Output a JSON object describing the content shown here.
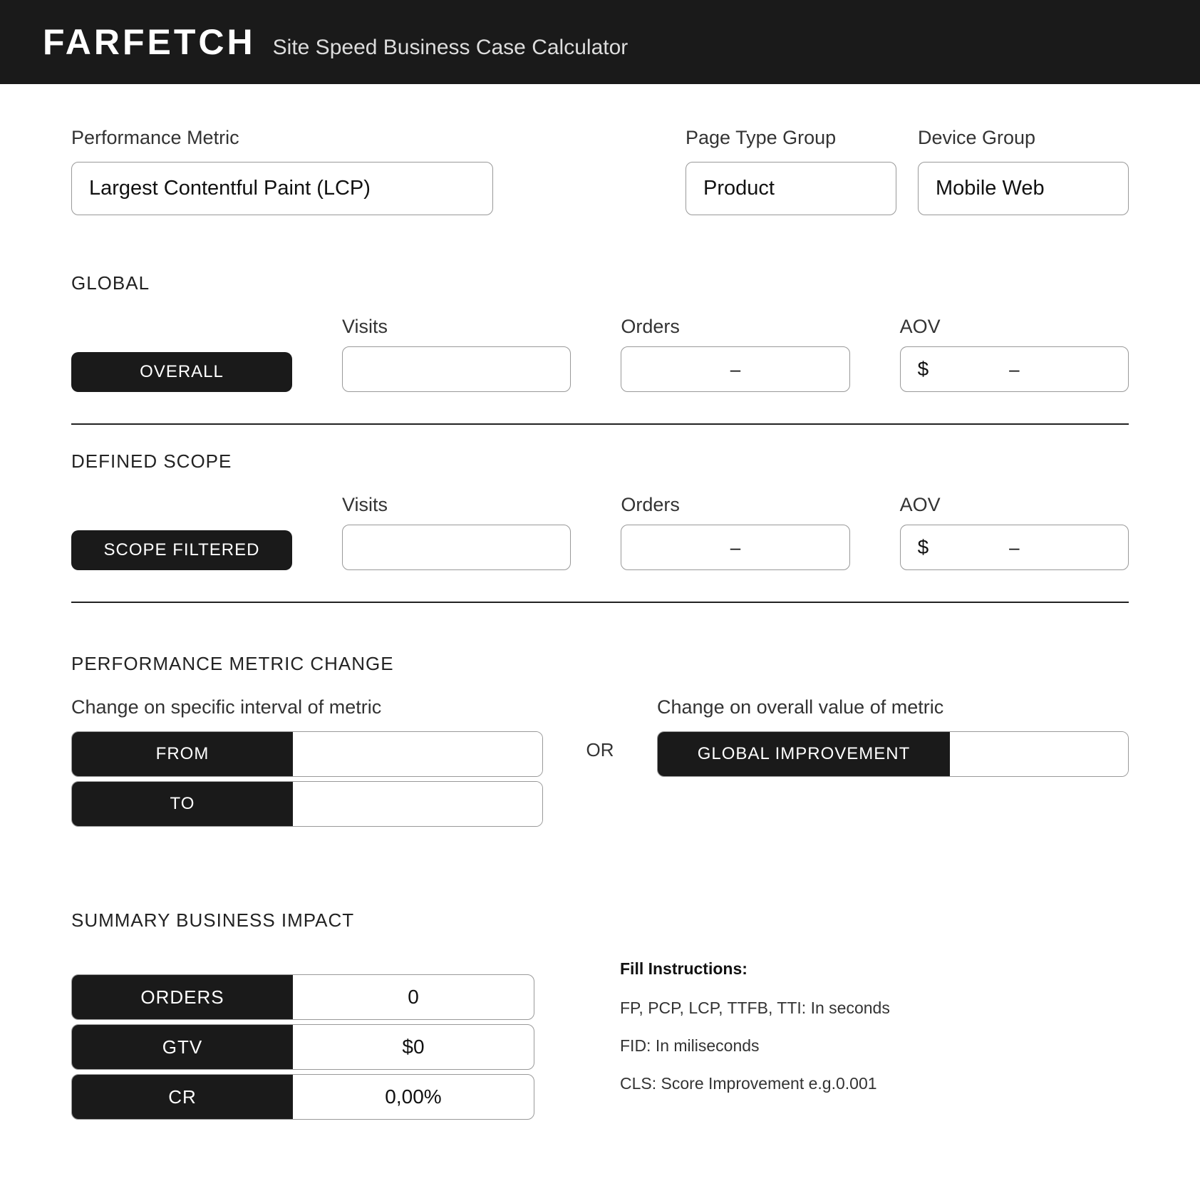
{
  "header": {
    "logo": "FARFETCH",
    "subtitle": "Site Speed Business Case Calculator"
  },
  "filters": {
    "metric": {
      "label": "Performance Metric",
      "value": "Largest Contentful Paint (LCP)"
    },
    "page": {
      "label": "Page Type Group",
      "value": "Product"
    },
    "device": {
      "label": "Device Group",
      "value": "Mobile Web"
    }
  },
  "global": {
    "label": "GLOBAL",
    "badge": "OVERALL",
    "visits": {
      "label": "Visits",
      "value": ""
    },
    "orders": {
      "label": "Orders",
      "value": "–"
    },
    "aov": {
      "label": "AOV",
      "prefix": "$",
      "value": "–"
    }
  },
  "scope": {
    "label": "DEFINED SCOPE",
    "badge": "SCOPE FILTERED",
    "visits": {
      "label": "Visits",
      "value": ""
    },
    "orders": {
      "label": "Orders",
      "value": "–"
    },
    "aov": {
      "label": "AOV",
      "prefix": "$",
      "value": "–"
    }
  },
  "change": {
    "label": "PERFORMANCE METRIC CHANGE",
    "specific": {
      "sublabel": "Change on specific interval of metric",
      "from_label": "FROM",
      "from_value": "",
      "to_label": "TO",
      "to_value": ""
    },
    "or": "OR",
    "overall": {
      "sublabel": "Change on overall value of metric",
      "global_label": "GLOBAL IMPROVEMENT",
      "global_value": ""
    }
  },
  "summary": {
    "label": "SUMMARY BUSINESS IMPACT",
    "orders": {
      "label": "ORDERS",
      "value": "0"
    },
    "gtv": {
      "label": "GTV",
      "value": "$0"
    },
    "cr": {
      "label": "CR",
      "value": "0,00%"
    }
  },
  "instructions": {
    "title": "Fill Instructions:",
    "line1": "FP, PCP, LCP, TTFB, TTI: In seconds",
    "line2": "FID: In miliseconds",
    "line3": "CLS: Score Improvement e.g.0.001"
  }
}
